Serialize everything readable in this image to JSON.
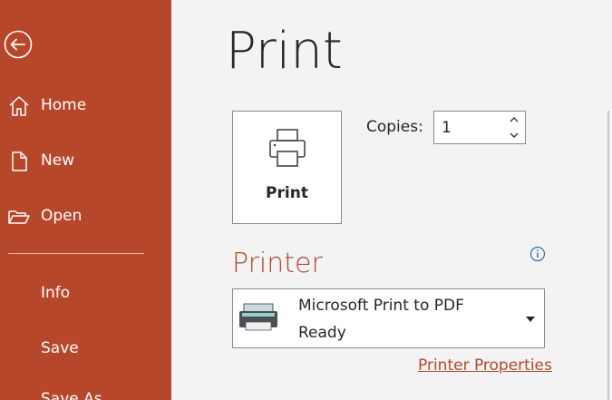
{
  "sidebar": {
    "back_icon": "arrow-left-circle-icon",
    "items": [
      {
        "label": "Home",
        "icon": "home-icon"
      },
      {
        "label": "New",
        "icon": "new-document-icon"
      },
      {
        "label": "Open",
        "icon": "folder-open-icon"
      },
      {
        "label": "Info"
      },
      {
        "label": "Save"
      },
      {
        "label": "Save As"
      }
    ]
  },
  "main": {
    "title": "Print",
    "print_button_label": "Print",
    "copies_label": "Copies:",
    "copies_value": "1",
    "printer_section_title": "Printer",
    "printer": {
      "name": "Microsoft Print to PDF",
      "status": "Ready"
    },
    "printer_properties_link": "Printer Properties"
  },
  "colors": {
    "accent": "#b7472a",
    "background": "#f3f3f3"
  }
}
